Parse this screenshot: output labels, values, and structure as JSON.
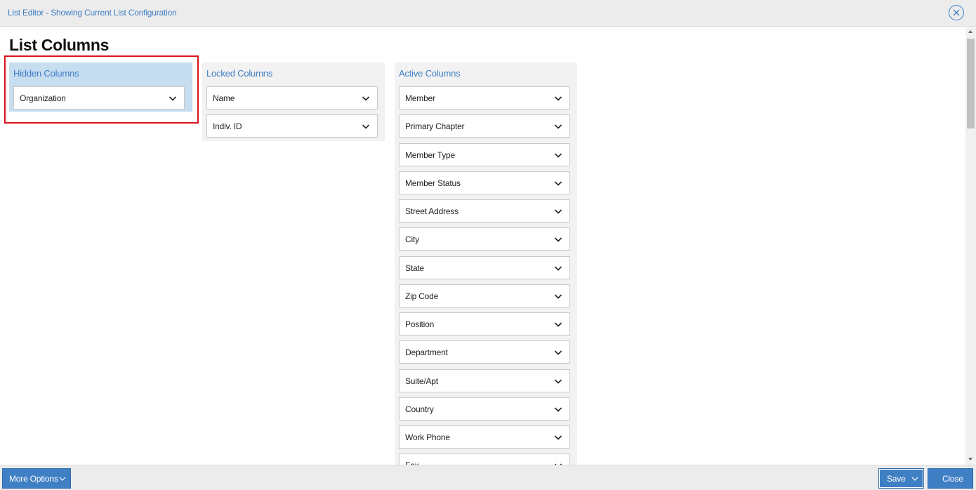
{
  "window": {
    "title": "List Editor - Showing Current List Configuration",
    "close_icon": "close-circle-icon"
  },
  "page": {
    "title": "List Columns"
  },
  "hidden_columns": {
    "header": "Hidden Columns",
    "items": [
      {
        "label": "Organization"
      }
    ]
  },
  "locked_columns": {
    "header": "Locked Columns",
    "items": [
      {
        "label": "Name"
      },
      {
        "label": "Indiv. ID"
      }
    ]
  },
  "active_columns": {
    "header": "Active Columns",
    "items": [
      {
        "label": "Member"
      },
      {
        "label": "Primary Chapter"
      },
      {
        "label": "Member Type"
      },
      {
        "label": "Member Status"
      },
      {
        "label": "Street Address"
      },
      {
        "label": "City"
      },
      {
        "label": "State"
      },
      {
        "label": "Zip Code"
      },
      {
        "label": "Position"
      },
      {
        "label": "Department"
      },
      {
        "label": "Suite/Apt"
      },
      {
        "label": "Country"
      },
      {
        "label": "Work Phone"
      },
      {
        "label": "Fax"
      }
    ]
  },
  "footer": {
    "more_options_label": "More Options",
    "save_label": "Save",
    "close_label": "Close"
  },
  "colors": {
    "accent": "#3f7fc4",
    "hidden_panel_bg": "#c7ddf0",
    "highlight_border": "#d8141c",
    "panel_bg": "#f2f2f2"
  }
}
